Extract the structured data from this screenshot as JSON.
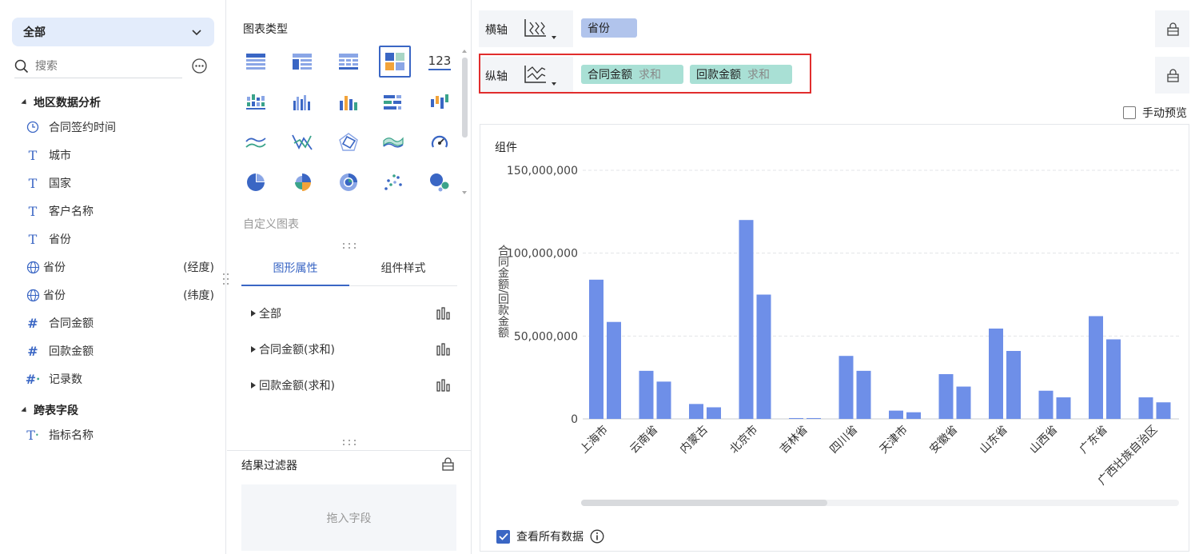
{
  "left_panel": {
    "dataset_select": "全部",
    "search": {
      "placeholder": "搜索"
    },
    "groups": [
      {
        "label": "地区数据分析"
      },
      {
        "label": "跨表字段"
      }
    ],
    "fields": [
      {
        "label": "合同签约时间",
        "icon": "clock-icon",
        "suffix": ""
      },
      {
        "label": "城市",
        "icon": "text-type-icon",
        "suffix": ""
      },
      {
        "label": "国家",
        "icon": "text-type-icon",
        "suffix": ""
      },
      {
        "label": "客户名称",
        "icon": "text-type-icon",
        "suffix": ""
      },
      {
        "label": "省份",
        "icon": "text-type-icon",
        "suffix": ""
      },
      {
        "label": "省份",
        "icon": "globe-icon",
        "suffix": "(经度)"
      },
      {
        "label": "省份",
        "icon": "globe-icon",
        "suffix": "(纬度)"
      },
      {
        "label": "合同金额",
        "icon": "number-type-icon",
        "suffix": ""
      },
      {
        "label": "回款金额",
        "icon": "number-type-icon",
        "suffix": ""
      },
      {
        "label": "记录数",
        "icon": "number-calc-icon",
        "suffix": ""
      }
    ],
    "cross_fields": [
      {
        "label": "指标名称",
        "icon": "text-calc-icon"
      }
    ]
  },
  "middle_panel": {
    "chart_type_title": "图表类型",
    "chart_type_number_glyph": "123",
    "custom_chart_label": "自定义图表",
    "tabs": [
      "图形属性",
      "组件样式"
    ],
    "property_rows": [
      "全部",
      "合同金额(求和)",
      "回款金额(求和)"
    ],
    "filter_title": "结果过滤器",
    "filter_drop_hint": "拖入字段"
  },
  "right_panel": {
    "x_axis": {
      "label": "横轴",
      "pills": [
        {
          "name": "省份",
          "agg": ""
        }
      ]
    },
    "y_axis": {
      "label": "纵轴",
      "pills": [
        {
          "name": "合同金额",
          "agg": "求和"
        },
        {
          "name": "回款金额",
          "agg": "求和"
        }
      ]
    },
    "manual_preview_label": "手动预览",
    "component_title": "组件",
    "view_all_label": "查看所有数据",
    "colors": {
      "bar": "#6e8fe8",
      "accent": "#3a66c4",
      "highlight": "#e12d2d"
    }
  },
  "chart_data": {
    "type": "bar",
    "ylabel": "合同金额/回款金额",
    "ylim": [
      0,
      150000000
    ],
    "yticks": [
      "0",
      "50,000,000",
      "100,000,000",
      "150,000,000"
    ],
    "categories": [
      "上海市",
      "云南省",
      "内蒙古",
      "北京市",
      "吉林省",
      "四川省",
      "天津市",
      "安徽省",
      "山东省",
      "山西省",
      "广东省",
      "广西壮族自治区"
    ],
    "series": [
      {
        "values": [
          84000000,
          29000000,
          9000000,
          120000000,
          500000,
          38000000,
          5000000,
          27000000,
          54500000,
          17000000,
          62000000,
          13000000
        ]
      },
      {
        "values": [
          58500000,
          22500000,
          7000000,
          75000000,
          500000,
          29000000,
          4000000,
          19500000,
          41000000,
          13000000,
          48000000,
          10000000
        ]
      }
    ],
    "grid": true,
    "legend": "none"
  }
}
